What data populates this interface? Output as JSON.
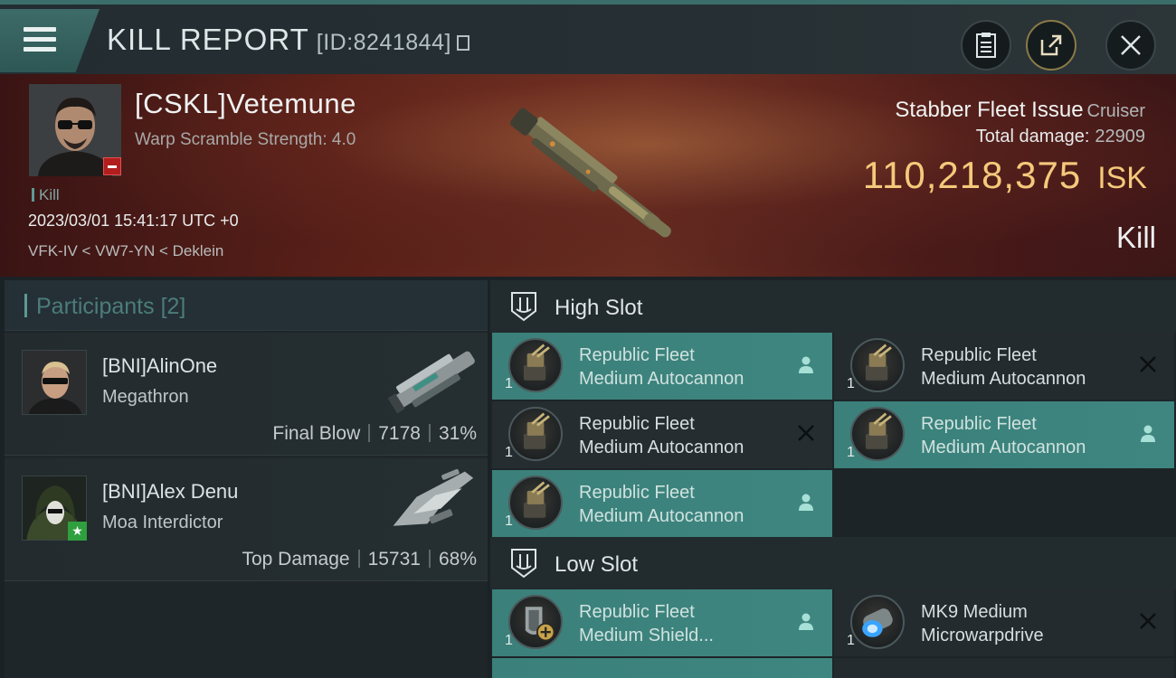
{
  "header": {
    "title": "KILL REPORT",
    "kill_id": "[ID:8241844]"
  },
  "victim": {
    "name": "[CSKL]Vetemune",
    "warp_scramble": "Warp Scramble Strength: 4.0",
    "kill_tag": "Kill",
    "timestamp": "2023/03/01 15:41:17 UTC +0",
    "location": "VFK-IV < VW7-YN < Deklein",
    "ship_name": "Stabber Fleet Issue",
    "ship_class": "Cruiser",
    "total_damage_label": "Total damage:",
    "total_damage": "22909",
    "isk_value": "110,218,375",
    "isk_unit": "ISK",
    "result": "Kill"
  },
  "participants": {
    "header_label": "Participants",
    "count": "[2]",
    "rows": [
      {
        "name": "[BNI]AlinOne",
        "ship": "Megathron",
        "role": "Final Blow",
        "damage": "7178",
        "percent": "31%"
      },
      {
        "name": "[BNI]Alex Denu",
        "ship": "Moa Interdictor",
        "role": "Top Damage",
        "damage": "15731",
        "percent": "68%"
      }
    ]
  },
  "fittings": {
    "high_slot_label": "High Slot",
    "low_slot_label": "Low Slot",
    "high_modules": [
      {
        "line1": "Republic Fleet",
        "line2": "Medium Autocannon",
        "qty": "1",
        "state": "dropped",
        "icon": "autocannon-icon"
      },
      {
        "line1": "Republic Fleet",
        "line2": "Medium Autocannon",
        "qty": "1",
        "state": "destroyed",
        "icon": "autocannon-icon"
      },
      {
        "line1": "Republic Fleet",
        "line2": "Medium Autocannon",
        "qty": "1",
        "state": "destroyed",
        "icon": "autocannon-icon"
      },
      {
        "line1": "Republic Fleet",
        "line2": "Medium Autocannon",
        "qty": "1",
        "state": "dropped",
        "icon": "autocannon-icon"
      },
      {
        "line1": "Republic Fleet",
        "line2": "Medium Autocannon",
        "qty": "1",
        "state": "dropped",
        "icon": "autocannon-icon"
      }
    ],
    "low_modules": [
      {
        "line1": "Republic Fleet",
        "line2": "Medium Shield...",
        "qty": "1",
        "state": "dropped",
        "icon": "shield-extender-icon"
      },
      {
        "line1": "MK9 Medium",
        "line2": "Microwarpdrive",
        "qty": "1",
        "state": "destroyed",
        "icon": "microwarpdrive-icon"
      }
    ]
  },
  "colors": {
    "accent_teal": "#3f8680",
    "isk_gold": "#f5c97b",
    "banner_red": "#6b2f22"
  }
}
